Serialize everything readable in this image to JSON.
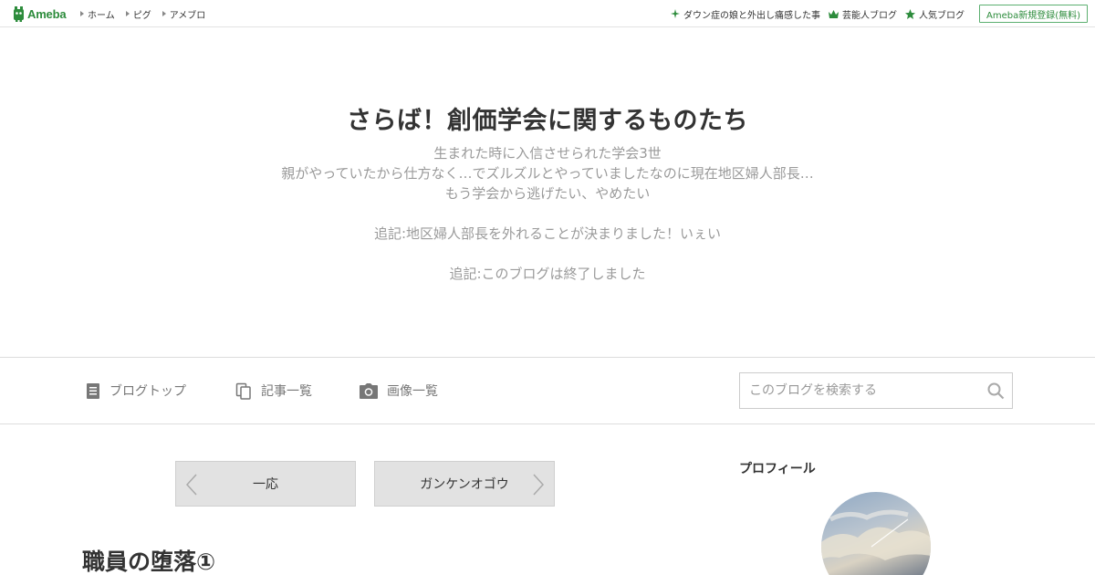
{
  "topbar": {
    "logo_text": "Ameba",
    "nav": [
      "ホーム",
      "ピグ",
      "アメブロ"
    ],
    "links": [
      {
        "label": "ダウン症の娘と外出し痛感した事",
        "icon": "sparkle-icon"
      },
      {
        "label": "芸能人ブログ",
        "icon": "crown-icon"
      },
      {
        "label": "人気ブログ",
        "icon": "star-icon"
      }
    ],
    "signup_label": "Ameba新規登録(無料)",
    "accent": "#2d8c3c"
  },
  "blog": {
    "title": "さらば！創価学会に関するものたち",
    "description": [
      "生まれた時に入信させられた学会3世",
      "親がやっていたから仕方なく…でズルズルとやっていましたなのに現在地区婦人部長…",
      "もう学会から逃げたい、やめたい",
      "",
      "追記:地区婦人部長を外れることが決まりました！いぇい",
      "",
      "追記:このブログは終了しました"
    ]
  },
  "blognav": {
    "items": [
      {
        "label": "ブログトップ",
        "icon": "document-icon"
      },
      {
        "label": "記事一覧",
        "icon": "copy-icon"
      },
      {
        "label": "画像一覧",
        "icon": "camera-icon"
      }
    ],
    "search_placeholder": "このブログを検索する"
  },
  "pager": {
    "prev_label": "一応",
    "next_label": "ガンケンオゴウ"
  },
  "entry": {
    "title": "職員の堕落①"
  },
  "sidebar": {
    "profile_heading": "プロフィール"
  }
}
